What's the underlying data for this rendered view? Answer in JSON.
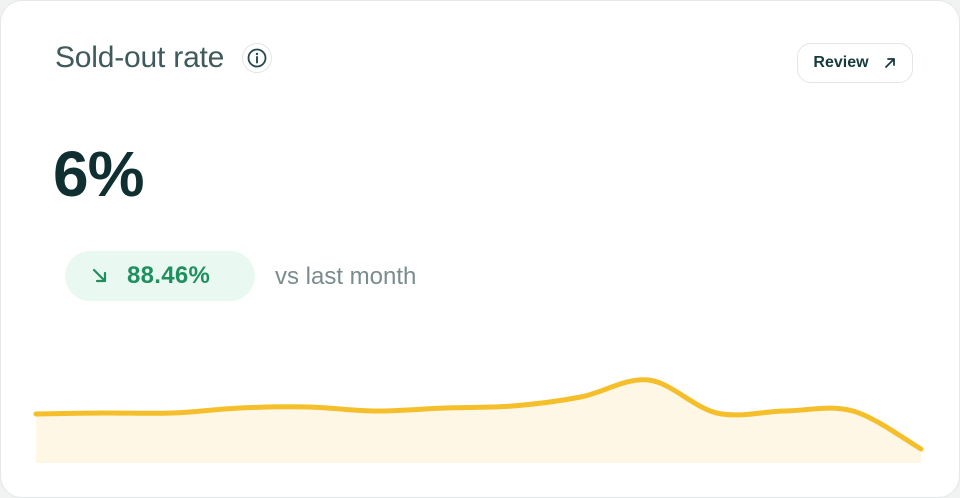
{
  "card": {
    "title": "Sold-out rate",
    "info_icon": "info-circle-icon",
    "review_label": "Review",
    "review_icon": "arrow-up-right-icon",
    "value": "6%",
    "change": {
      "value": "88.46%",
      "direction": "down",
      "icon": "arrow-down-right-icon",
      "comparison_text": "vs last month"
    }
  },
  "colors": {
    "line": "#f4bf2a",
    "fill": "#fdf4dc",
    "positive_text": "#1f8f5d",
    "badge_bg": "#e9f8f1"
  },
  "chart_data": {
    "type": "area",
    "title": "",
    "xlabel": "",
    "ylabel": "",
    "values": [
      10,
      11,
      11,
      16,
      17,
      13,
      16,
      18,
      27,
      44,
      11,
      13,
      13,
      -25
    ]
  }
}
